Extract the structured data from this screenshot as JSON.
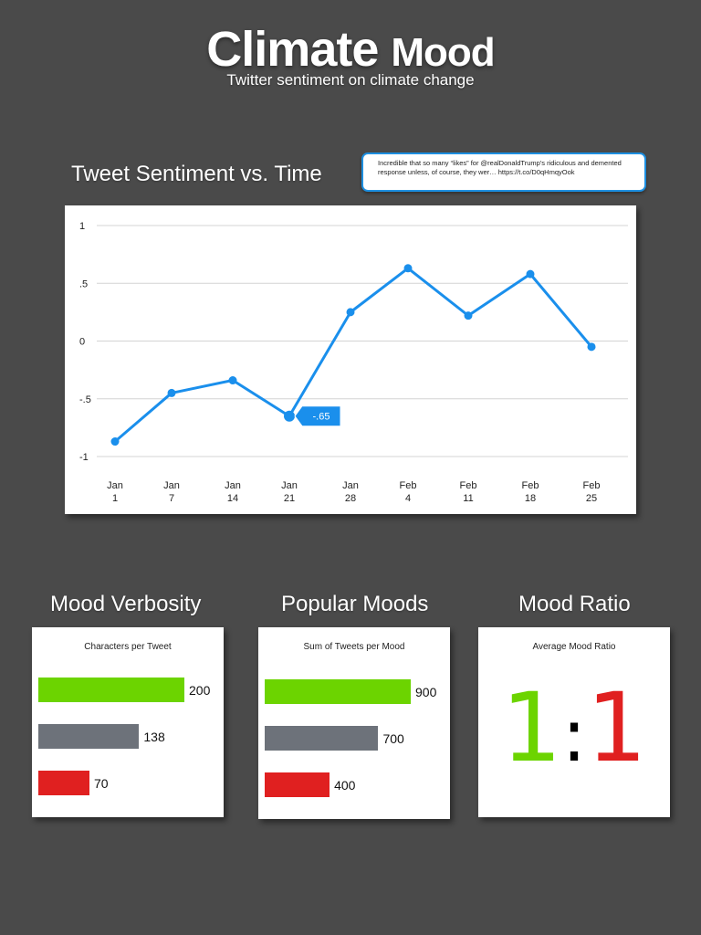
{
  "header": {
    "title_main": "Climate",
    "title_small": "Mood",
    "subtitle": "Twitter sentiment on climate change"
  },
  "line_section": {
    "title": "Tweet Sentiment vs. Time",
    "tweet": "Incredible that so many “likes” for @realDonaldTrump's ridiculous and demented response unless, of course, they wer… https://t.co/D0qHmqyOok"
  },
  "chart_data": [
    {
      "type": "line",
      "title": "Tweet Sentiment vs. Time",
      "x": [
        "Jan 1",
        "Jan 7",
        "Jan 14",
        "Jan 21",
        "Jan 28",
        "Feb 4",
        "Feb 11",
        "Feb 18",
        "Feb 25"
      ],
      "x_tick_lines": [
        [
          "Jan",
          "1"
        ],
        [
          "Jan",
          "7"
        ],
        [
          "Jan",
          "14"
        ],
        [
          "Jan",
          "21"
        ],
        [
          "Jan",
          "28"
        ],
        [
          "Feb",
          "4"
        ],
        [
          "Feb",
          "11"
        ],
        [
          "Feb",
          "18"
        ],
        [
          "Feb",
          "25"
        ]
      ],
      "series": [
        {
          "values": [
            -0.87,
            -0.45,
            -0.34,
            -0.65,
            0.25,
            0.63,
            0.22,
            0.58,
            -0.05
          ]
        }
      ],
      "ylim": [
        -1,
        1
      ],
      "y_ticks": [
        1,
        0.5,
        0,
        -0.5,
        -1
      ],
      "y_tick_labels": [
        "1",
        ".5",
        "0",
        "-.5",
        "-1"
      ],
      "grid": true,
      "color": "#1a8fec",
      "highlight": {
        "index": 3,
        "label": "-.65"
      }
    },
    {
      "type": "bar",
      "title": "Characters per Tweet",
      "values": [
        200,
        138,
        70
      ],
      "colors": [
        "#6cd400",
        "#6d727a",
        "#e02020"
      ]
    },
    {
      "type": "bar",
      "title": "Sum of Tweets per Mood",
      "values": [
        900,
        700,
        400
      ],
      "colors": [
        "#6cd400",
        "#6d727a",
        "#e02020"
      ]
    }
  ],
  "verbosity": {
    "title": "Mood Verbosity",
    "caption": "Characters per Tweet"
  },
  "popular": {
    "title": "Popular Moods",
    "caption": "Sum of Tweets per Mood"
  },
  "ratio": {
    "title": "Mood Ratio",
    "caption": "Average Mood Ratio",
    "positive": "1",
    "separator": ":",
    "negative": "1",
    "positive_color": "#6cd400",
    "negative_color": "#e02020"
  }
}
